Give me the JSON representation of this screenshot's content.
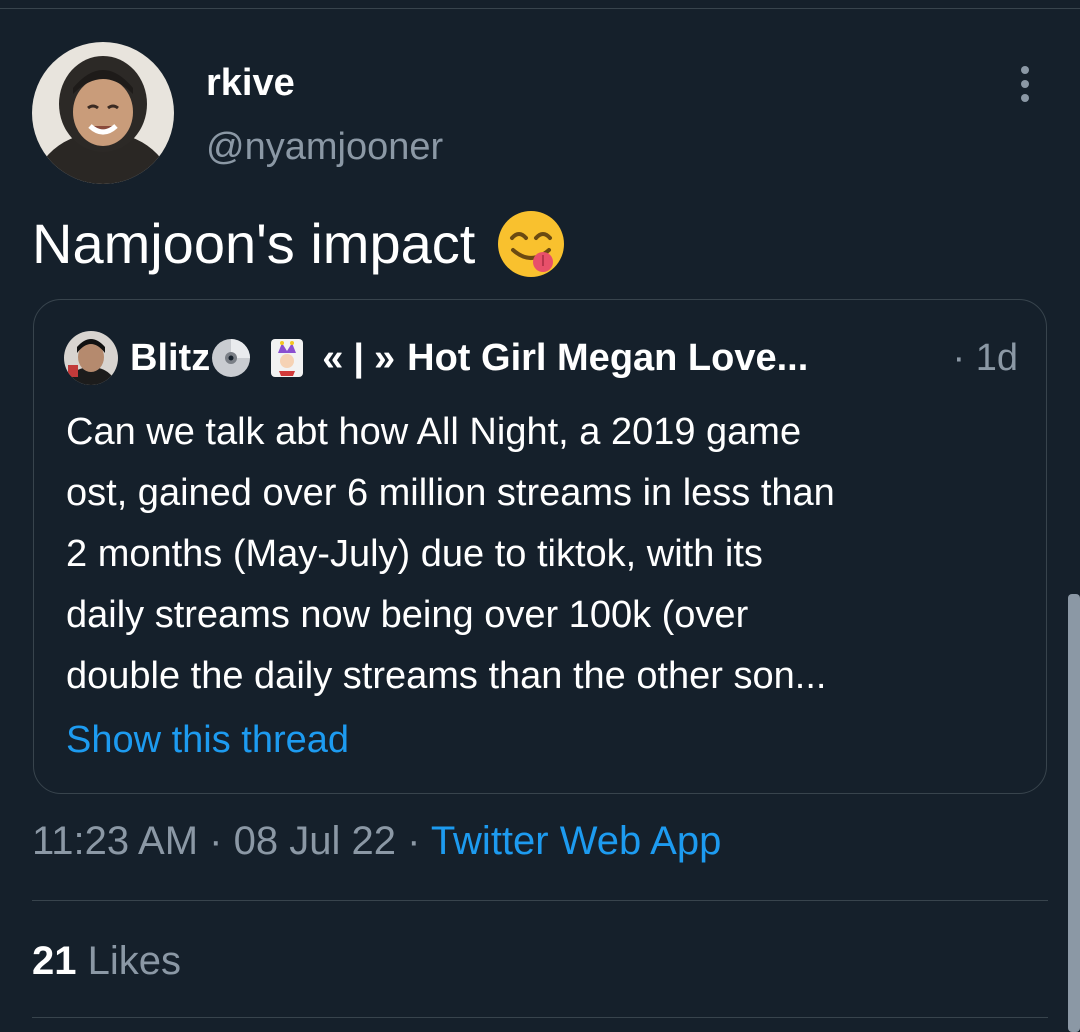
{
  "tweet": {
    "display_name": "rkive",
    "handle": "@nyamjooner",
    "text": "Namjoon's impact",
    "emoji": "face-savoring-food-emoji",
    "timestamp": "11:23 AM",
    "date": "08 Jul 22",
    "separator": "·",
    "source": "Twitter Web App",
    "likes_count": "21",
    "likes_label": "Likes"
  },
  "quote": {
    "name_part1": "Blitz",
    "name_part2": "«",
    "name_part3": "|",
    "name_part4": "»",
    "name_part5": "Hot Girl Megan Love...",
    "time": "· 1d",
    "lines": [
      "Can we talk abt how All Night, a 2019 game",
      "ost, gained over 6 million streams in less than",
      "2 months (May-July) due to tiktok, with its",
      "daily streams now being over 100k (over",
      "double the daily streams than the other son..."
    ],
    "show_thread": "Show this thread"
  },
  "icons": {
    "more": "more-vertical-icon",
    "disc": "optical-disc-emoji",
    "joker": "joker-card-emoji"
  },
  "colors": {
    "background": "#15202b",
    "border": "#38444d",
    "secondary_text": "#8b98a5",
    "link": "#1d9bf0"
  }
}
